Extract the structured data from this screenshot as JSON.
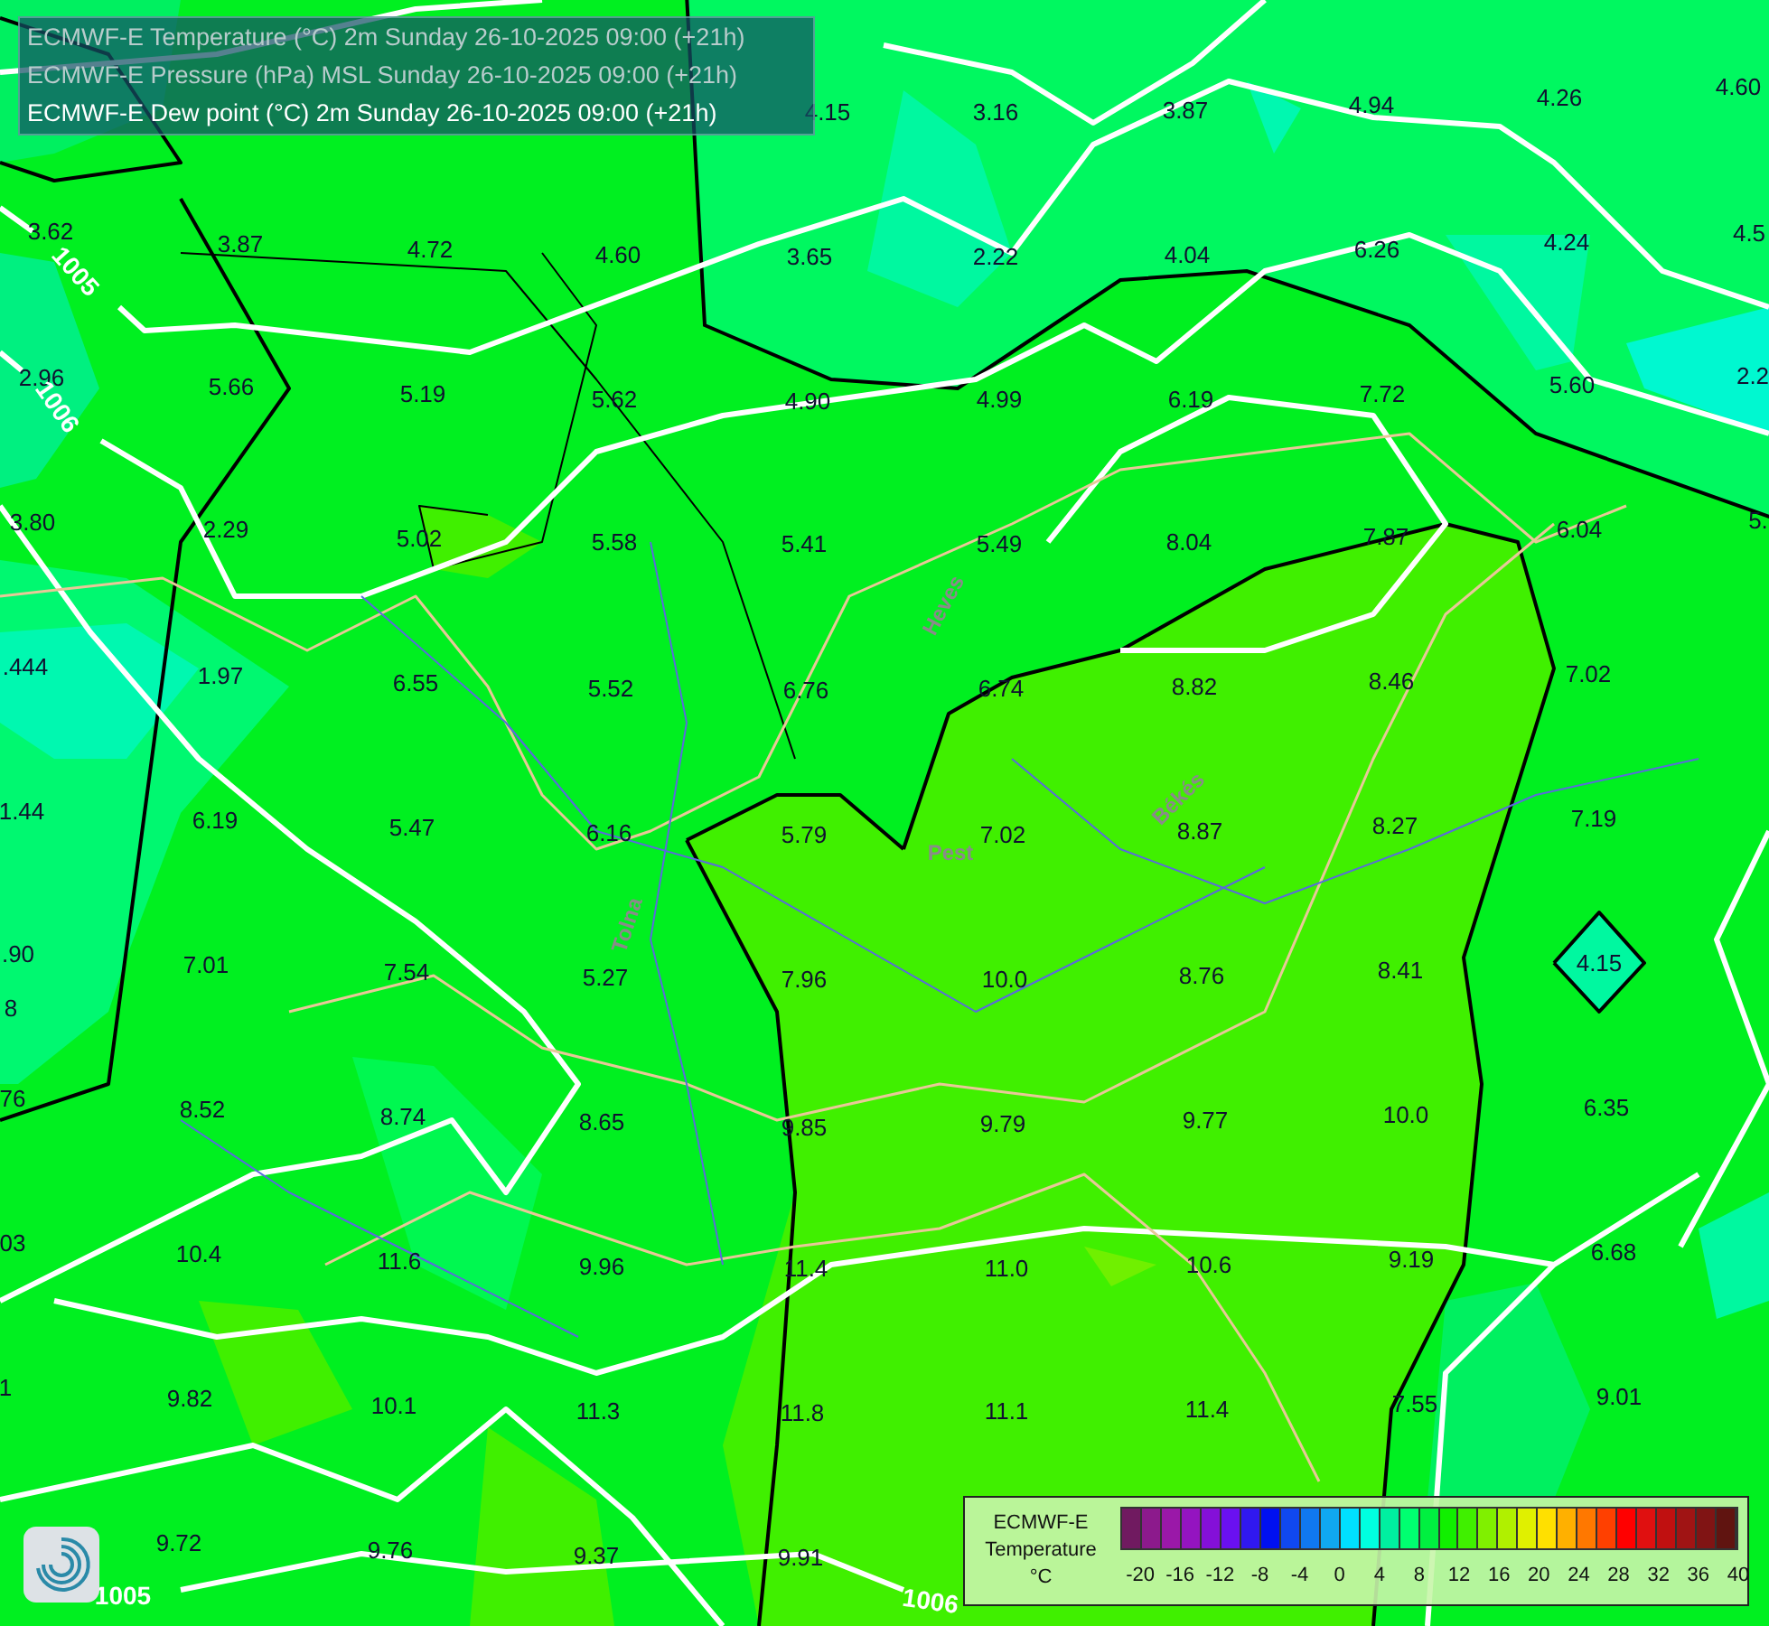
{
  "header": {
    "lines": [
      {
        "text": "ECMWF-E Temperature (°C) 2m Sunday 26-10-2025 09:00 (+21h)",
        "active": false
      },
      {
        "text": "ECMWF-E Pressure (hPa) MSL Sunday 26-10-2025 09:00 (+21h)",
        "active": false
      },
      {
        "text": "ECMWF-E Dew point (°C) 2m Sunday 26-10-2025 09:00 (+21h)",
        "active": true
      }
    ]
  },
  "pressure_labels": [
    "1005",
    "1006",
    "1005",
    "1006"
  ],
  "place_names": [
    "Heves",
    "Békés",
    "Pest",
    "Tolna"
  ],
  "temperatures": [
    "4.15",
    "3.16",
    "3.87",
    "4.94",
    "4.26",
    "4.60",
    "3.62",
    "3.87",
    "4.72",
    "4.60",
    "3.65",
    "2.22",
    "4.04",
    "6.26",
    "4.24",
    "4.5",
    "2.96",
    "5.66",
    "5.19",
    "5.62",
    "4.90",
    "4.99",
    "6.19",
    "7.72",
    "5.60",
    "2.2",
    "3.80",
    "2.29",
    "5.02",
    "5.58",
    "5.41",
    "5.49",
    "8.04",
    "7.87",
    "6.04",
    "5.",
    ".444",
    "1.97",
    "6.55",
    "5.52",
    "6.76",
    "6.74",
    "8.82",
    "8.46",
    "7.02",
    "1.44",
    "6.19",
    "5.47",
    "6.16",
    "5.79",
    "7.02",
    "8.87",
    "8.27",
    "7.19",
    ".90",
    "7.01",
    "7.54",
    "5.27",
    "7.96",
    "10.0",
    "8.76",
    "8.41",
    "4.15",
    "8",
    "76",
    "8.52",
    "8.74",
    "8.65",
    "9.85",
    "9.79",
    "9.77",
    "10.0",
    "6.35",
    "03",
    "10.4",
    "11.6",
    "9.96",
    "11.4",
    "11.0",
    "10.6",
    "9.19",
    "6.68",
    "1",
    "9.82",
    "10.1",
    "11.3",
    "11.8",
    "11.1",
    "11.4",
    "7.55",
    "9.01",
    "9.72",
    "9.76",
    "9.37",
    "9.91"
  ],
  "legend": {
    "title_lines": [
      "ECMWF-E",
      "Temperature",
      "°C"
    ],
    "swatches": [
      {
        "color": "#701a60"
      },
      {
        "color": "#8c1a8c"
      },
      {
        "color": "#9a18a8"
      },
      {
        "color": "#9414c0"
      },
      {
        "color": "#8410d8"
      },
      {
        "color": "#6a10f0"
      },
      {
        "color": "#3018f0"
      },
      {
        "color": "#0010f0"
      },
      {
        "color": "#1048f0"
      },
      {
        "color": "#1078f0"
      },
      {
        "color": "#10a8f0"
      },
      {
        "color": "#00e0ff"
      },
      {
        "color": "#00ffe0"
      },
      {
        "color": "#00f0a0"
      },
      {
        "color": "#00ff70"
      },
      {
        "color": "#00f040"
      },
      {
        "color": "#10f000"
      },
      {
        "color": "#40f000"
      },
      {
        "color": "#80f000"
      },
      {
        "color": "#b0f000"
      },
      {
        "color": "#e0f000"
      },
      {
        "color": "#ffe000"
      },
      {
        "color": "#ffb000"
      },
      {
        "color": "#ff7800"
      },
      {
        "color": "#ff4000"
      },
      {
        "color": "#ff0000"
      },
      {
        "color": "#e01010"
      },
      {
        "color": "#c01010"
      },
      {
        "color": "#a01414"
      },
      {
        "color": "#801414"
      },
      {
        "color": "#601410"
      }
    ],
    "ticks": [
      "-20",
      "-16",
      "-12",
      "-8",
      "-4",
      "0",
      "4",
      "8",
      "12",
      "16",
      "20",
      "24",
      "28",
      "32",
      "36",
      "40"
    ]
  }
}
